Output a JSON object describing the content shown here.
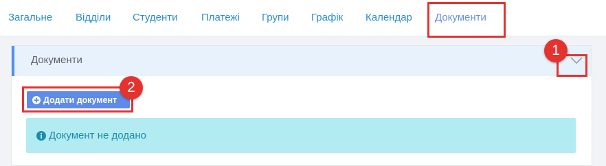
{
  "tabs": [
    {
      "label": "Загальне"
    },
    {
      "label": "Відділи"
    },
    {
      "label": "Студенти"
    },
    {
      "label": "Платежі"
    },
    {
      "label": "Групи"
    },
    {
      "label": "Графік"
    },
    {
      "label": "Календар"
    },
    {
      "label": "Документи",
      "active": true
    }
  ],
  "panel": {
    "title": "Документи",
    "add_button_label": "Додати документ",
    "empty_message": "Документ не додано"
  },
  "annotations": {
    "badge_1": "1",
    "badge_2": "2"
  },
  "colors": {
    "tab_link": "#2a8fd0",
    "tab_active": "#6a8fe0",
    "highlight": "#e5322f",
    "header_bg": "#e8f2fd",
    "header_accent": "#4f8ff0",
    "button_bg": "#5e8ae8",
    "alert_bg": "#b2ebf1",
    "alert_text": "#1d8cab"
  },
  "icons": {
    "collapse": "chevron-down-icon",
    "add": "plus-circle-icon",
    "info": "info-circle-icon"
  }
}
